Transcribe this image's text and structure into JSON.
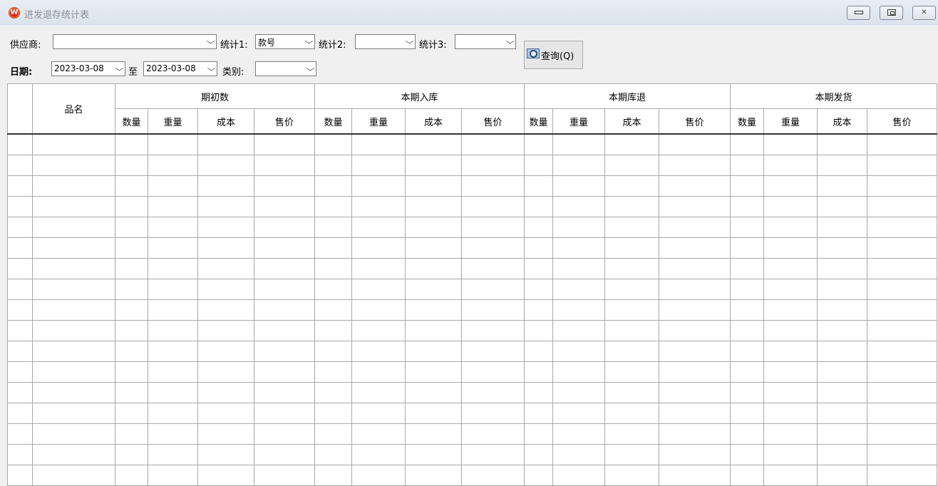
{
  "window": {
    "title": "进发退存统计表",
    "app_icon_letter": "W"
  },
  "filters": {
    "supplier_label": "供应商:",
    "supplier_value": "",
    "stat1_label": "统计1:",
    "stat1_value": "款号",
    "stat2_label": "统计2:",
    "stat2_value": "",
    "stat3_label": "统计3:",
    "stat3_value": "",
    "date_label": "日期:",
    "date_from": "2023-03-08",
    "date_to_label": "至",
    "date_to": "2023-03-08",
    "category_label": "类别:",
    "category_value": "",
    "query_button": "查询(Q)"
  },
  "grid": {
    "name_header": "品名",
    "groups": [
      "期初数",
      "本期入库",
      "本期库退",
      "本期发货"
    ],
    "sub_columns": [
      "数量",
      "重量",
      "成本",
      "售价"
    ]
  },
  "colors": {
    "title_bar": "#dbe3ee",
    "window_bg": "#f0f0f0",
    "grid_line": "#a9a9a9"
  }
}
